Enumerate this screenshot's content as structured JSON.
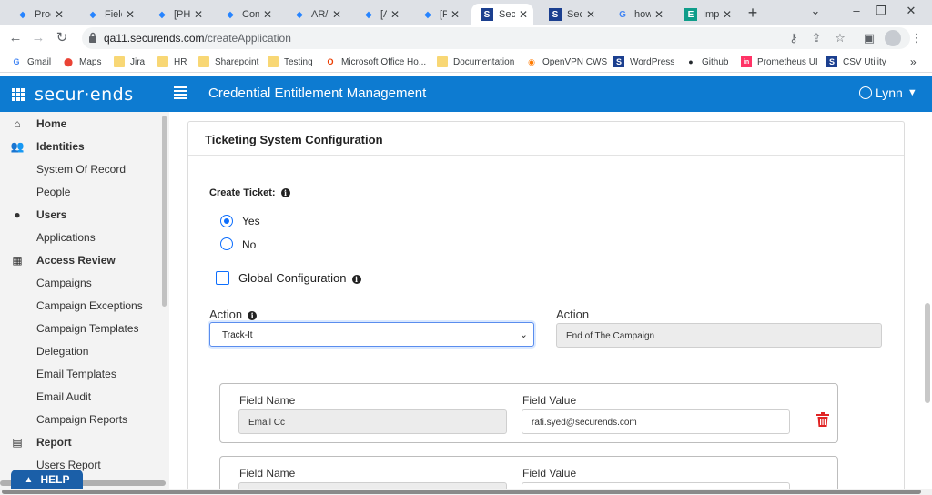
{
  "browser": {
    "tabs": [
      {
        "title": "Prod",
        "favicon": "jira-icon",
        "active": false
      },
      {
        "title": "Field",
        "favicon": "jira-icon",
        "active": false
      },
      {
        "title": "[PHE",
        "favicon": "jira-icon",
        "active": false
      },
      {
        "title": "Conn",
        "favicon": "jira-icon",
        "active": false
      },
      {
        "title": "AR/I",
        "favicon": "jira-icon",
        "active": false
      },
      {
        "title": "[All C",
        "favicon": "jira-icon",
        "active": false
      },
      {
        "title": "[PHE",
        "favicon": "jira-icon",
        "active": false
      },
      {
        "title": "Secu",
        "favicon": "securends-icon",
        "active": true
      },
      {
        "title": "Secu",
        "favicon": "securends-icon",
        "active": false
      },
      {
        "title": "how",
        "favicon": "google-icon",
        "active": false
      },
      {
        "title": "Imple",
        "favicon": "exchange-icon",
        "active": false
      }
    ],
    "url_host": "qa11.securends.com",
    "url_path": "/createApplication",
    "bookmarks": [
      {
        "label": "Gmail",
        "icon": "google-icon"
      },
      {
        "label": "Maps",
        "icon": "maps-icon"
      },
      {
        "label": "Jira",
        "icon": "folder-icon"
      },
      {
        "label": "HR",
        "icon": "folder-icon"
      },
      {
        "label": "Sharepoint",
        "icon": "folder-icon"
      },
      {
        "label": "Testing",
        "icon": "folder-icon"
      },
      {
        "label": "Microsoft Office Ho...",
        "icon": "office-icon"
      },
      {
        "label": "Documentation",
        "icon": "folder-icon"
      },
      {
        "label": "OpenVPN CWS",
        "icon": "openvpn-icon"
      },
      {
        "label": "WordPress",
        "icon": "securends-icon"
      },
      {
        "label": "Github",
        "icon": "github-icon"
      },
      {
        "label": "Prometheus UI",
        "icon": "invision-icon"
      },
      {
        "label": "CSV Utility",
        "icon": "securends-icon"
      }
    ],
    "more": "»"
  },
  "app": {
    "logo": "secur·ends",
    "title": "Credential Entitlement Management",
    "user": "Lynn",
    "brand_color": "#0d7bd1"
  },
  "sidebar": {
    "items": [
      {
        "label": "Home",
        "section": true,
        "icon": "home-icon"
      },
      {
        "label": "Identities",
        "section": true,
        "icon": "people-icon"
      },
      {
        "label": "System Of Record",
        "section": false
      },
      {
        "label": "People",
        "section": false
      },
      {
        "label": "Users",
        "section": true,
        "icon": "user-icon"
      },
      {
        "label": "Applications",
        "section": false
      },
      {
        "label": "Access Review",
        "section": true,
        "icon": "grid-icon"
      },
      {
        "label": "Campaigns",
        "section": false
      },
      {
        "label": "Campaign Exceptions",
        "section": false
      },
      {
        "label": "Campaign Templates",
        "section": false
      },
      {
        "label": "Delegation",
        "section": false
      },
      {
        "label": "Email Templates",
        "section": false
      },
      {
        "label": "Email Audit",
        "section": false
      },
      {
        "label": "Campaign Reports",
        "section": false
      },
      {
        "label": "Report",
        "section": true,
        "icon": "report-icon"
      },
      {
        "label": "Users Report",
        "section": false
      }
    ]
  },
  "ticketing": {
    "card_title": "Ticketing System Configuration",
    "create_ticket_label": "Create Ticket:",
    "radio_yes": "Yes",
    "radio_no": "No",
    "selected": "Yes",
    "global_config_label": "Global Configuration",
    "global_config_checked": false,
    "action_label_left": "Action",
    "action_value_left": "Track-It",
    "action_label_right": "Action",
    "action_value_right": "End of The Campaign",
    "fields": [
      {
        "name_label": "Field Name",
        "name_value": "Email Cc",
        "value_label": "Field Value",
        "value": "rafi.syed@securends.com"
      },
      {
        "name_label": "Field Name",
        "name_value": "",
        "value_label": "Field Value",
        "value": ""
      }
    ]
  },
  "help": {
    "label": "HELP"
  }
}
